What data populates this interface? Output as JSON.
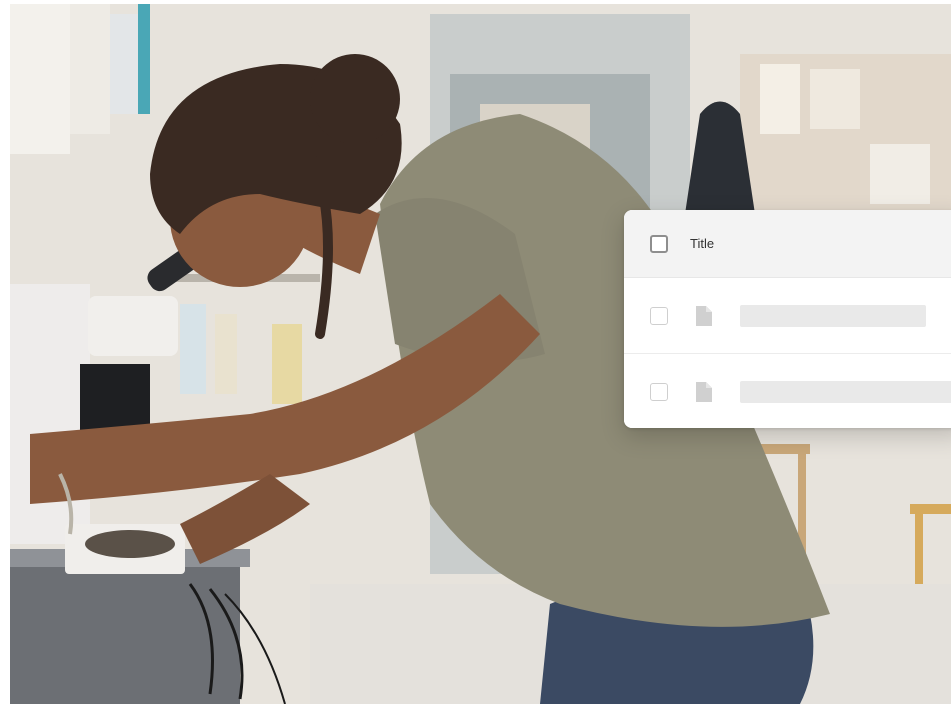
{
  "photo": {
    "subject": "student-using-microscope",
    "palette": {
      "wall": "#e9e6e0",
      "shirt": "#8e8b76",
      "skin": "#8a5a3e",
      "hair": "#3a2a22",
      "jeans": "#3b4a63",
      "counter": "#6c6f74"
    }
  },
  "table_card": {
    "header": {
      "title_label": "Title"
    },
    "rows": [
      {
        "icon": "file-icon"
      },
      {
        "icon": "file-icon"
      }
    ],
    "colors": {
      "header_bg": "#f3f3f3",
      "placeholder": "#e9e9e9",
      "icon": "#d0d0d0"
    }
  }
}
